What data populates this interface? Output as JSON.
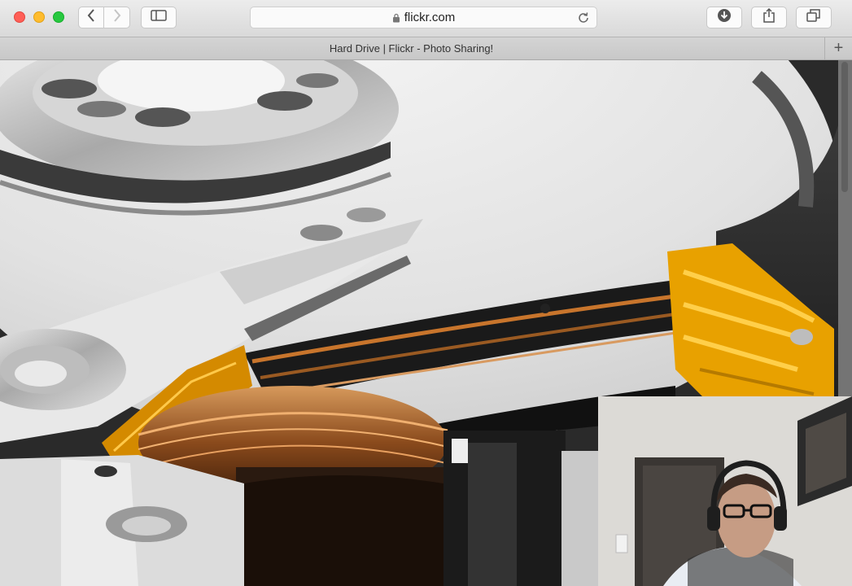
{
  "browser": {
    "url": "flickr.com",
    "tab_title": "Hard Drive | Flickr - Photo Sharing!",
    "new_tab_symbol": "+"
  },
  "icons": {
    "back": "chevron-left-icon",
    "forward": "chevron-right-icon",
    "sidebar": "sidebar-icon",
    "lock": "lock-icon",
    "reload": "reload-icon",
    "download": "download-icon",
    "share": "share-icon",
    "tabs": "tabs-overview-icon"
  },
  "colors": {
    "close": "#ff5f57",
    "minimize": "#febc2e",
    "maximize": "#28c840",
    "flex_cable": "#e8a100",
    "copper": "#b8662a"
  }
}
